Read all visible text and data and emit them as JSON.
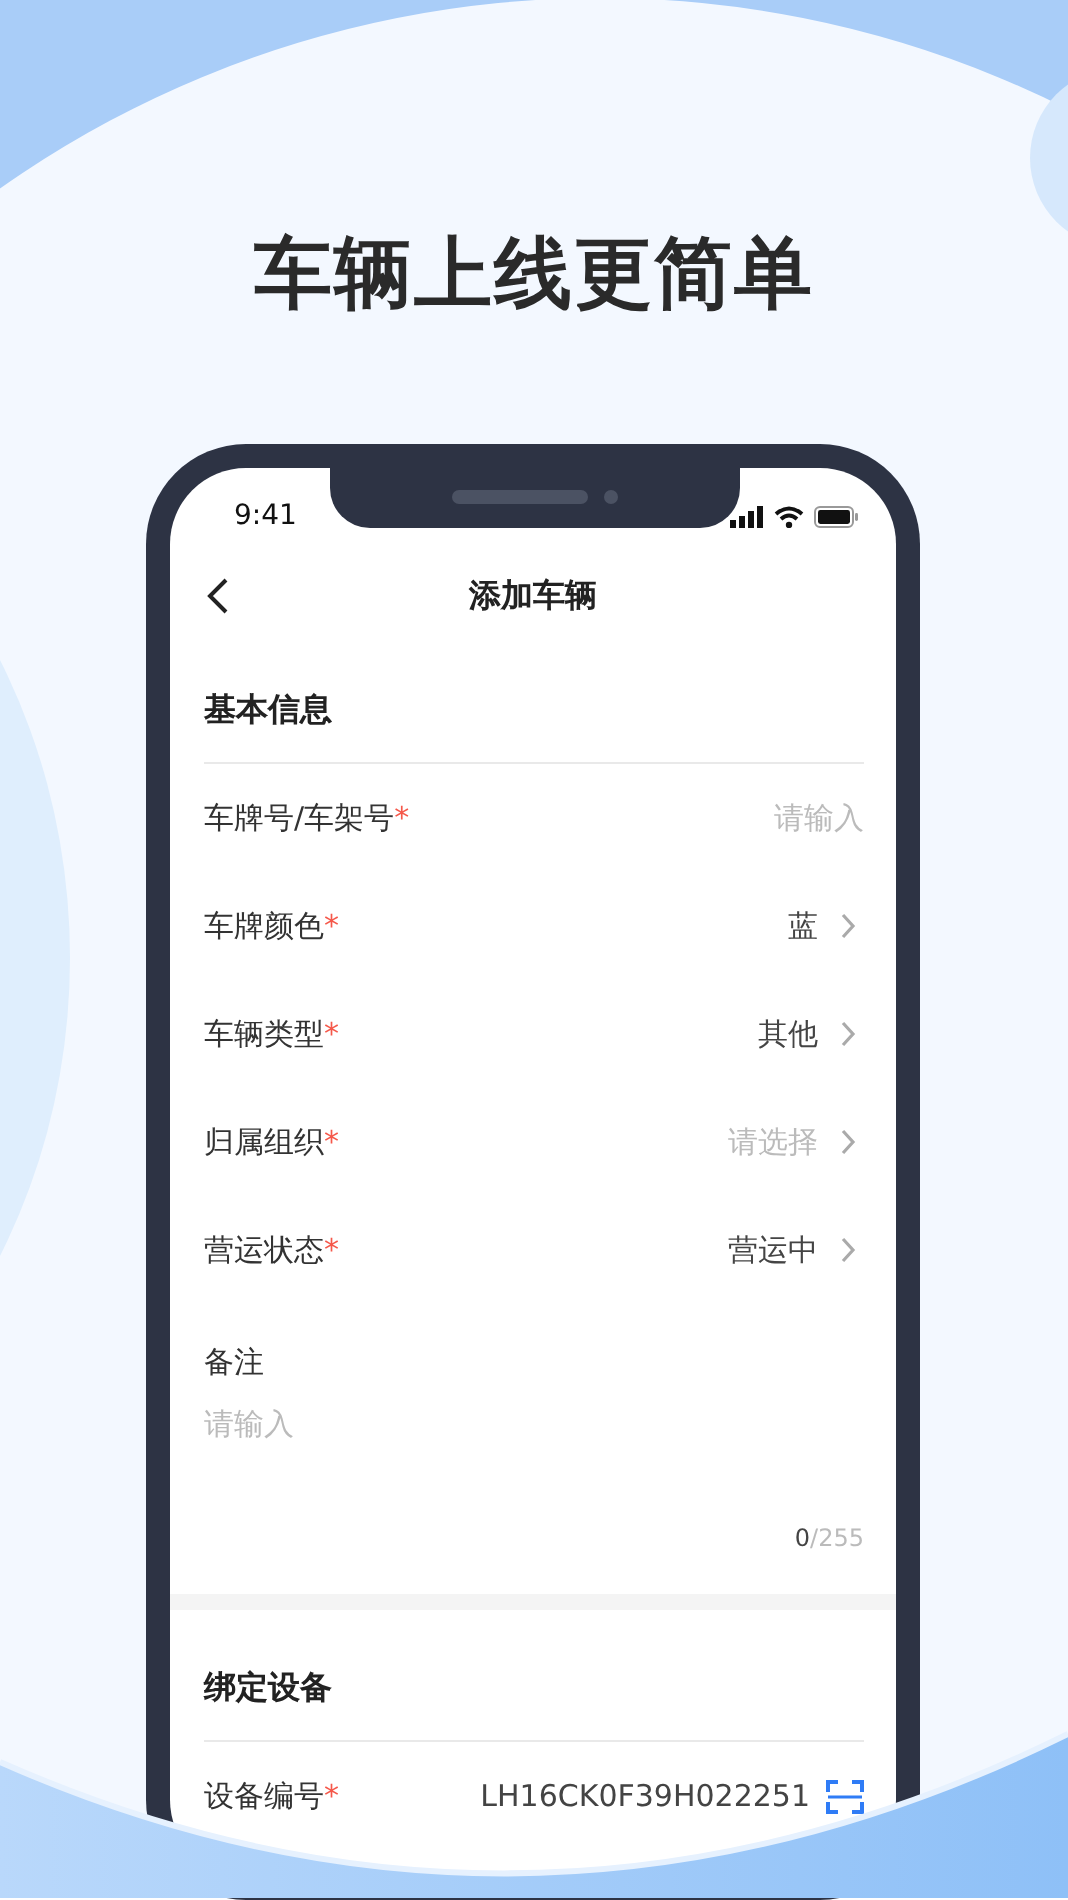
{
  "headline": "车辆上线更简单",
  "status_bar": {
    "time": "9:41"
  },
  "nav": {
    "title": "添加车辆"
  },
  "required_mark": "*",
  "sections": [
    {
      "title": "基本信息",
      "fields": [
        {
          "kind": "input",
          "label": "车牌号/车架号",
          "required": true,
          "placeholder": "请输入"
        },
        {
          "kind": "select",
          "label": "车牌颜色",
          "required": true,
          "value": "蓝"
        },
        {
          "kind": "select",
          "label": "车辆类型",
          "required": true,
          "value": "其他"
        },
        {
          "kind": "select",
          "label": "归属组织",
          "required": true,
          "placeholder": "请选择"
        },
        {
          "kind": "select",
          "label": "营运状态",
          "required": true,
          "value": "营运中"
        },
        {
          "kind": "textarea",
          "label": "备注",
          "required": false,
          "placeholder": "请输入",
          "count": "0",
          "max": "/255"
        }
      ]
    },
    {
      "title": "绑定设备",
      "fields": [
        {
          "kind": "scan",
          "label": "设备编号",
          "required": true,
          "value": "LH16CK0F39H022251"
        }
      ]
    }
  ]
}
